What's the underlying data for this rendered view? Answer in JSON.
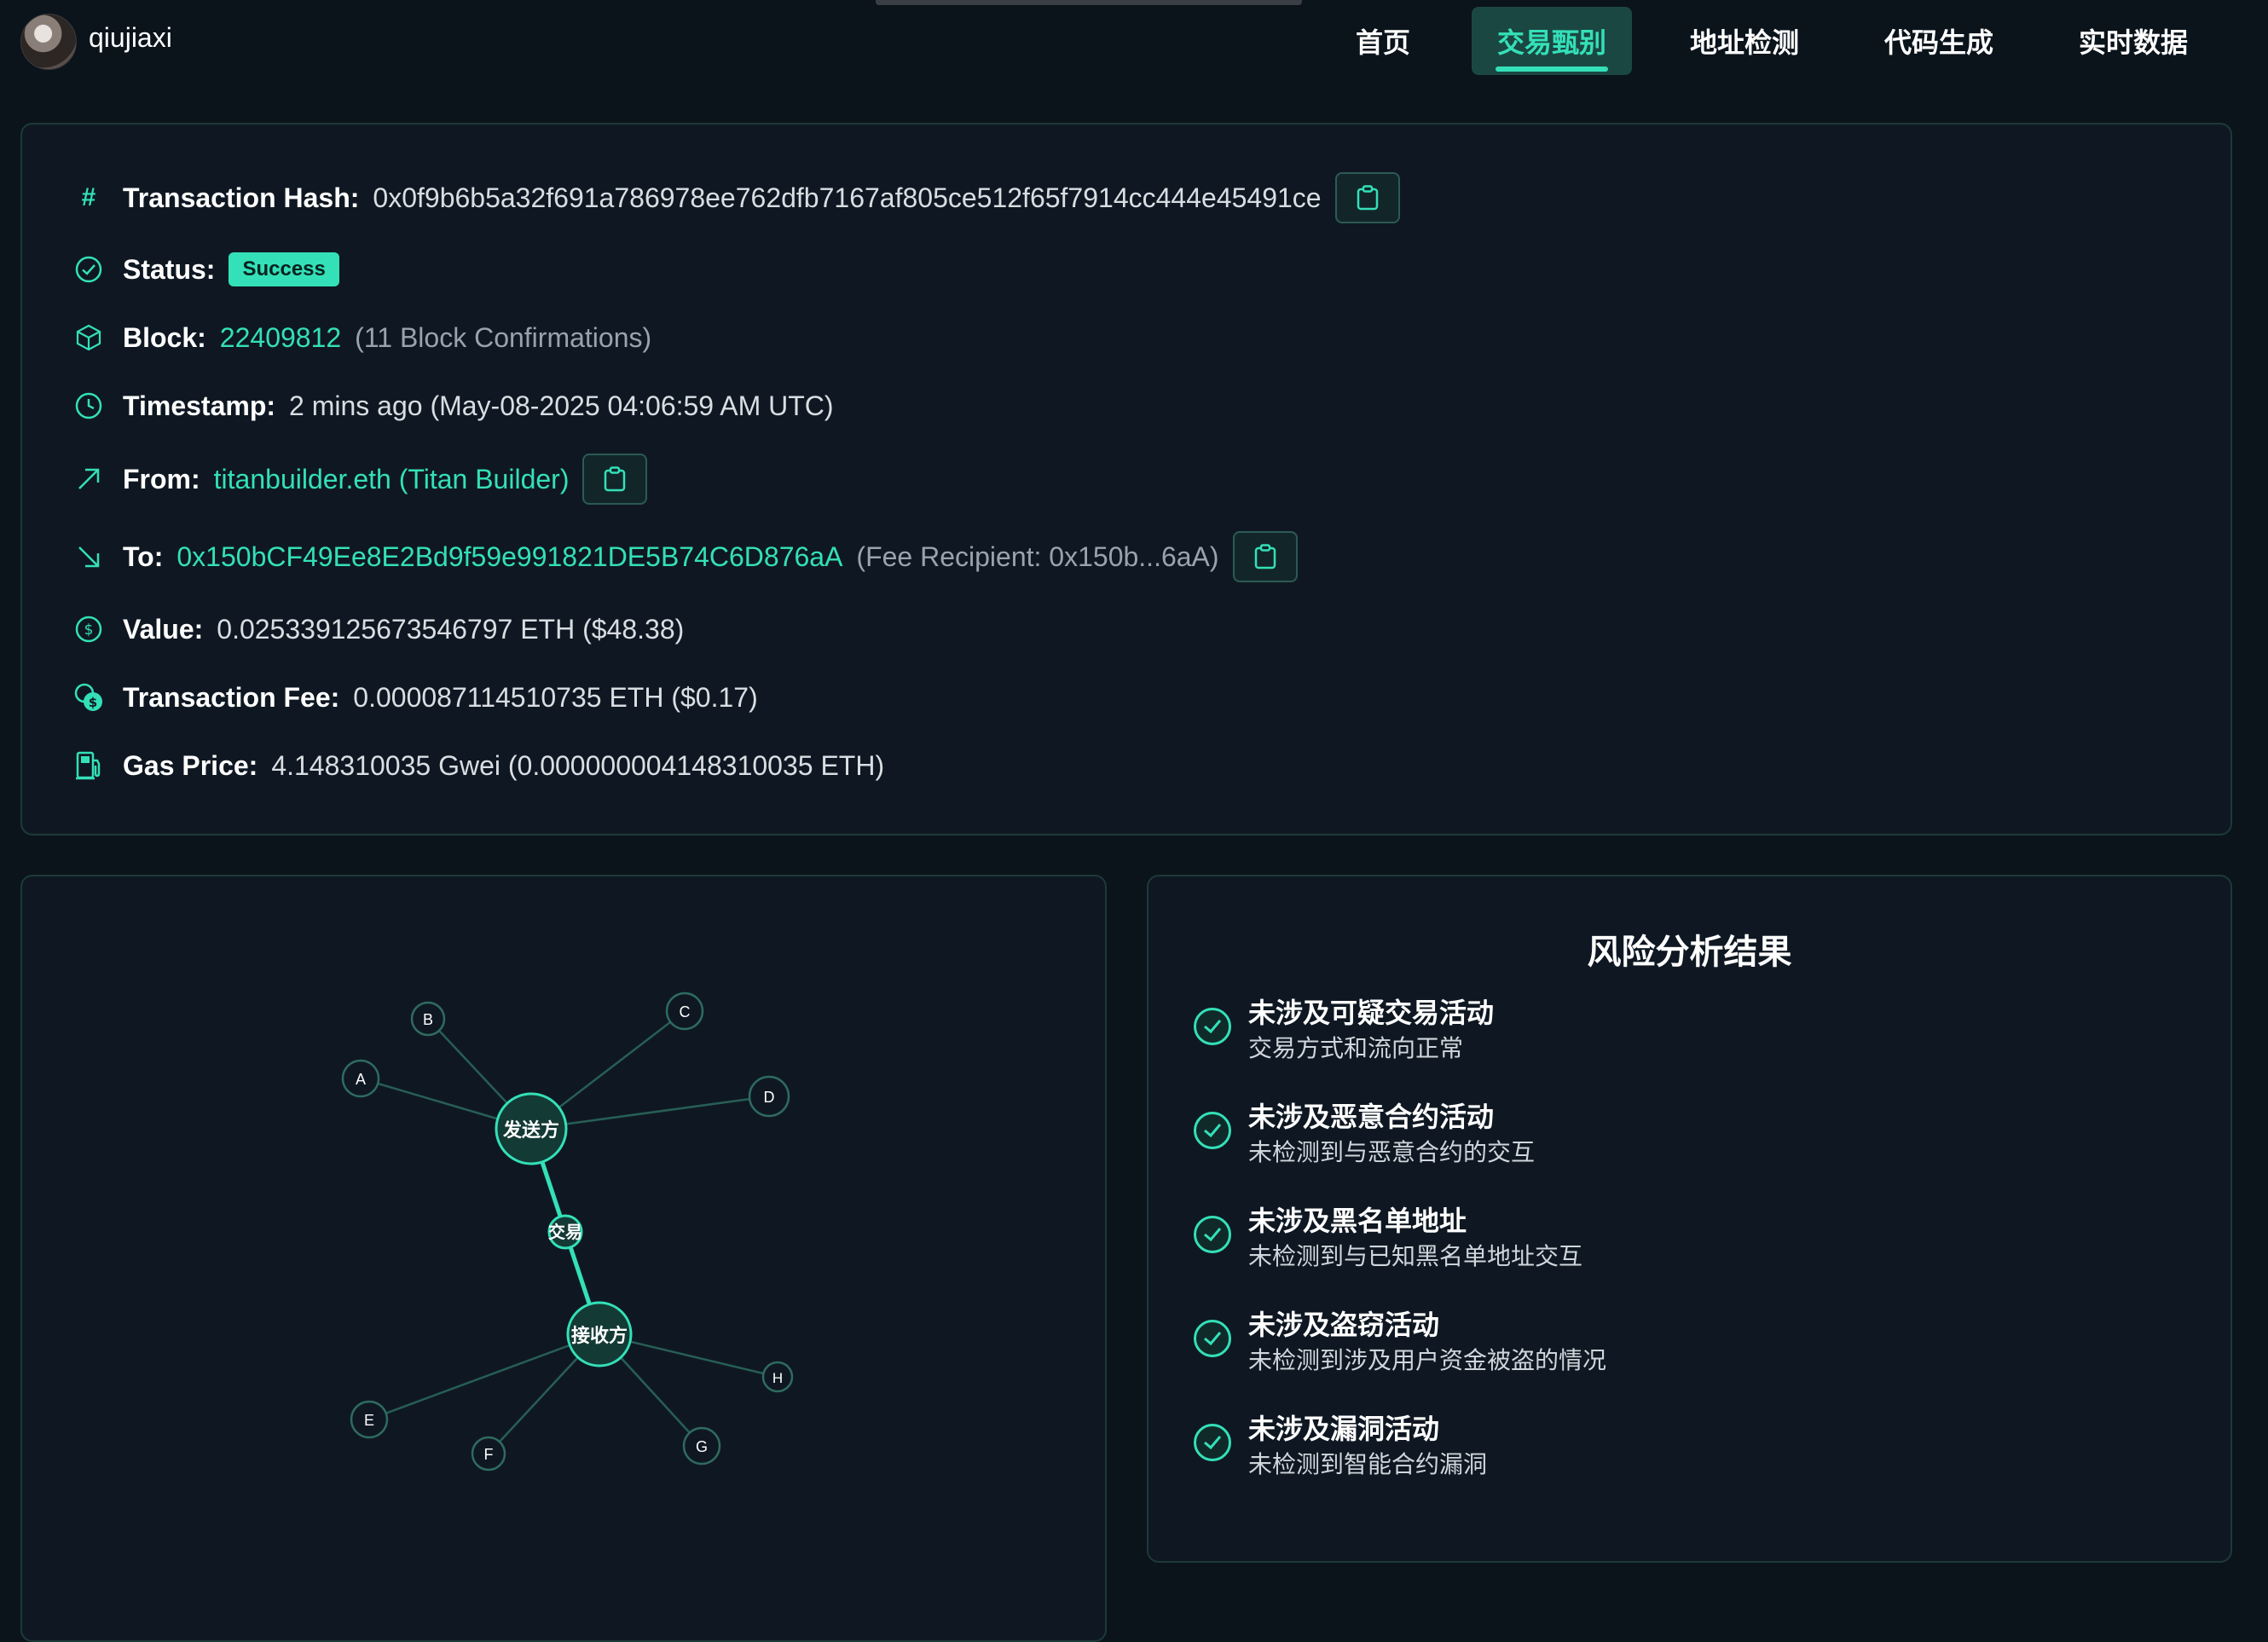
{
  "user": {
    "name": "qiujiaxi"
  },
  "nav": {
    "items": [
      {
        "label": "首页"
      },
      {
        "label": "交易甄别"
      },
      {
        "label": "地址检测"
      },
      {
        "label": "代码生成"
      },
      {
        "label": "实时数据"
      }
    ],
    "active_index": 1
  },
  "tx": {
    "hash_label": "Transaction Hash:",
    "hash": "0x0f9b6b5a32f691a786978ee762dfb7167af805ce512f65f7914cc444e45491ce",
    "status_label": "Status:",
    "status": "Success",
    "block_label": "Block:",
    "block": "22409812",
    "block_confirmations": "(11 Block Confirmations)",
    "timestamp_label": "Timestamp:",
    "timestamp": "2 mins ago (May-08-2025 04:06:59 AM UTC)",
    "from_label": "From:",
    "from": "titanbuilder.eth (Titan Builder)",
    "to_label": "To:",
    "to": "0x150bCF49Ee8E2Bd9f59e991821DE5B74C6D876aA",
    "to_note": "(Fee Recipient: 0x150b...6aA)",
    "value_label": "Value:",
    "value": "0.025339125673546797 ETH ($48.38)",
    "fee_label": "Transaction Fee:",
    "fee": "0.000087114510735 ETH ($0.17)",
    "gas_label": "Gas Price:",
    "gas": "4.148310035 Gwei (0.000000004148310035 ETH)"
  },
  "graph": {
    "sender": "发送方",
    "transaction": "交易",
    "receiver": "接收方",
    "nodes": [
      "A",
      "B",
      "C",
      "D",
      "E",
      "F",
      "G",
      "H"
    ]
  },
  "risk": {
    "title": "风险分析结果",
    "items": [
      {
        "title": "未涉及可疑交易活动",
        "desc": "交易方式和流向正常"
      },
      {
        "title": "未涉及恶意合约活动",
        "desc": "未检测到与恶意合约的交互"
      },
      {
        "title": "未涉及黑名单地址",
        "desc": "未检测到与已知黑名单地址交互"
      },
      {
        "title": "未涉及盗窃活动",
        "desc": "未检测到涉及用户资金被盗的情况"
      },
      {
        "title": "未涉及漏洞活动",
        "desc": "未检测到智能合约漏洞"
      }
    ]
  },
  "colors": {
    "accent": "#34e0b8",
    "background": "#0b131b",
    "card": "#0f1822"
  },
  "icons": [
    "hash-icon",
    "check-circle-icon",
    "cube-icon",
    "clock-icon",
    "arrow-up-right-icon",
    "arrow-down-right-icon",
    "dollar-coin-icon",
    "coins-icon",
    "gas-pump-icon",
    "clipboard-icon"
  ]
}
